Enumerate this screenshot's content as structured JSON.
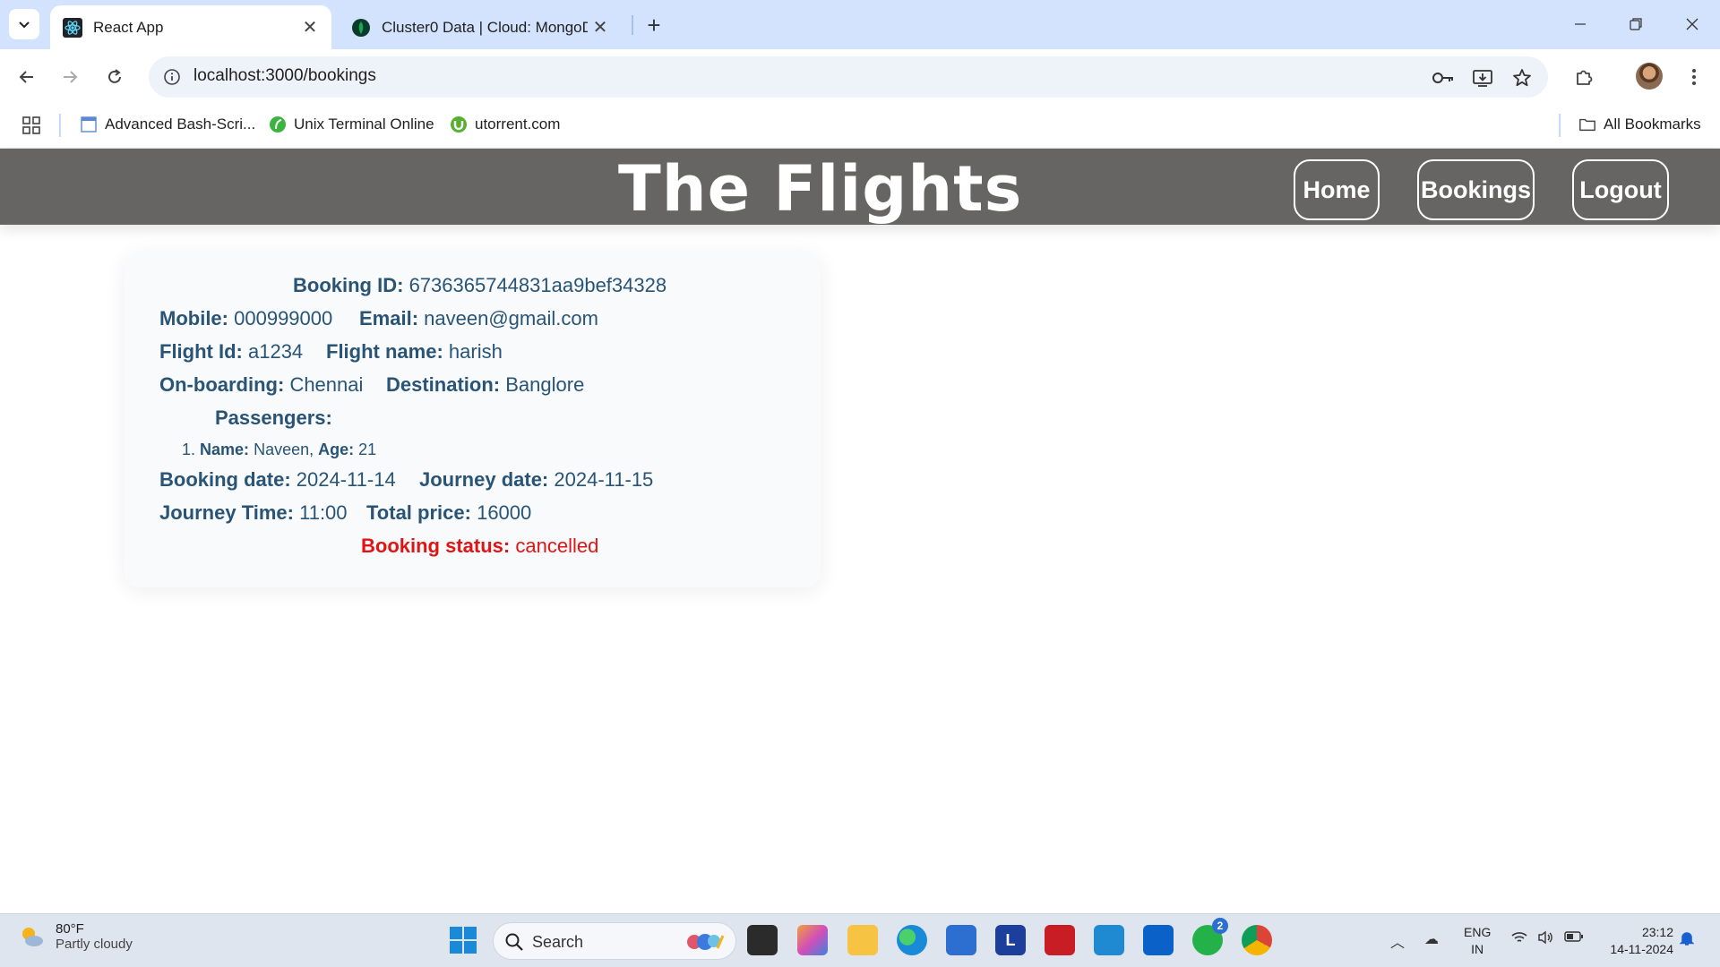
{
  "browser": {
    "tabs": [
      {
        "title": "React App",
        "active": true
      },
      {
        "title": "Cluster0 Data | Cloud: MongoDB",
        "active": false
      }
    ],
    "url": "localhost:3000/bookings",
    "bookmarks": [
      {
        "label": "Advanced Bash-Scri..."
      },
      {
        "label": "Unix Terminal Online"
      },
      {
        "label": "utorrent.com"
      }
    ],
    "all_bookmarks_label": "All Bookmarks"
  },
  "app": {
    "brand": "The Flights",
    "nav": {
      "home": "Home",
      "bookings": "Bookings",
      "logout": "Logout"
    }
  },
  "booking": {
    "id_label": "Booking ID:",
    "id": "6736365744831aa9bef34328",
    "mobile_label": "Mobile:",
    "mobile": "000999000",
    "email_label": "Email:",
    "email": "naveen@gmail.com",
    "flight_id_label": "Flight Id:",
    "flight_id": "a1234",
    "flight_name_label": "Flight name:",
    "flight_name": "harish",
    "onboarding_label": "On-boarding:",
    "onboarding": "Chennai",
    "destination_label": "Destination:",
    "destination": "Banglore",
    "passengers_label": "Passengers:",
    "passengers": [
      {
        "index": "1.",
        "name_label": "Name:",
        "name": "Naveen,",
        "age_label": "Age:",
        "age": "21"
      }
    ],
    "booking_date_label": "Booking date:",
    "booking_date": "2024-11-14",
    "journey_date_label": "Journey date:",
    "journey_date": "2024-11-15",
    "journey_time_label": "Journey Time:",
    "journey_time": "11:00",
    "total_price_label": "Total price:",
    "total_price": "16000",
    "status_label": "Booking status:",
    "status": "cancelled"
  },
  "taskbar": {
    "weather_temp": "80°F",
    "weather_cond": "Partly cloudy",
    "search_label": "Search",
    "whatsapp_badge": "2",
    "lang_line1": "ENG",
    "lang_line2": "IN",
    "time": "23:12",
    "date": "14-11-2024"
  },
  "colors": {
    "header_bg": "#676564",
    "card_text": "#295475",
    "status_text": "#e01414",
    "tabstrip_bg": "#d3e3fd"
  }
}
